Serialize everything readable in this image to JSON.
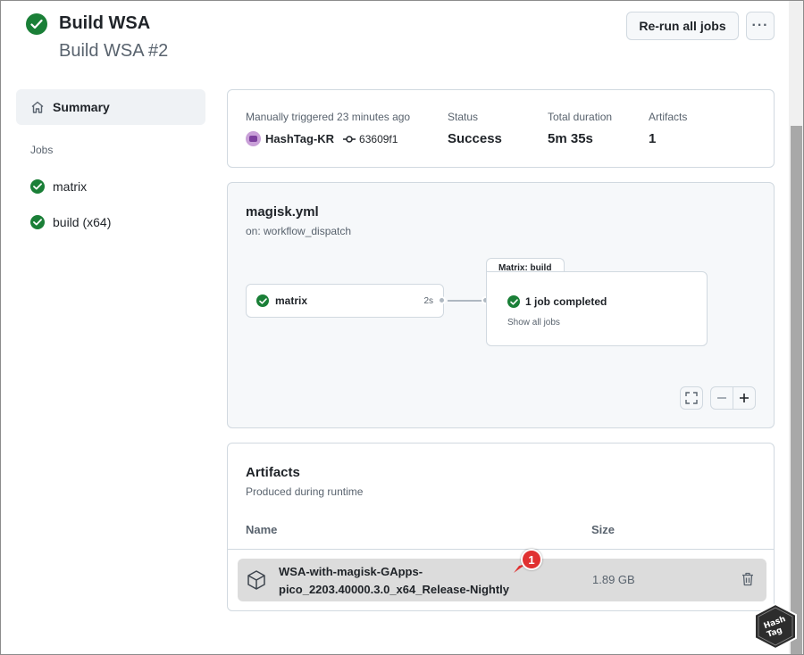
{
  "header": {
    "title": "Build WSA",
    "run_name": "Build WSA #2",
    "rerun_label": "Re-run all jobs",
    "more_label": "···"
  },
  "sidebar": {
    "summary_label": "Summary",
    "jobs_heading": "Jobs",
    "jobs": [
      {
        "label": "matrix",
        "status": "success"
      },
      {
        "label": "build (x64)",
        "status": "success"
      }
    ]
  },
  "summary": {
    "trigger_text": "Manually triggered 23 minutes ago",
    "actor": "HashTag-KR",
    "commit_sha": "63609f1",
    "status_label": "Status",
    "status_value": "Success",
    "duration_label": "Total duration",
    "duration_value": "5m 35s",
    "artifacts_label": "Artifacts",
    "artifacts_value": "1"
  },
  "graph": {
    "workflow_file": "magisk.yml",
    "trigger": "on: workflow_dispatch",
    "job_name": "matrix",
    "job_duration": "2s",
    "matrix_tab": "Matrix: build",
    "matrix_status": "1 job completed",
    "matrix_link": "Show all jobs"
  },
  "artifacts": {
    "title": "Artifacts",
    "subtitle": "Produced during runtime",
    "col_name": "Name",
    "col_size": "Size",
    "rows": [
      {
        "name": "WSA-with-magisk-GApps-pico_2203.40000.3.0_x64_Release-Nightly",
        "size": "1.89 GB"
      }
    ]
  },
  "annotation": {
    "callout_number": "1"
  },
  "colors": {
    "success": "#1a7f37",
    "callout": "#e03131",
    "row_highlight": "#dcdcdc"
  },
  "icons": [
    "check-circle-icon",
    "home-icon",
    "git-commit-icon",
    "fullscreen-icon",
    "zoom-out-icon",
    "zoom-in-icon",
    "package-icon",
    "trash-icon"
  ]
}
